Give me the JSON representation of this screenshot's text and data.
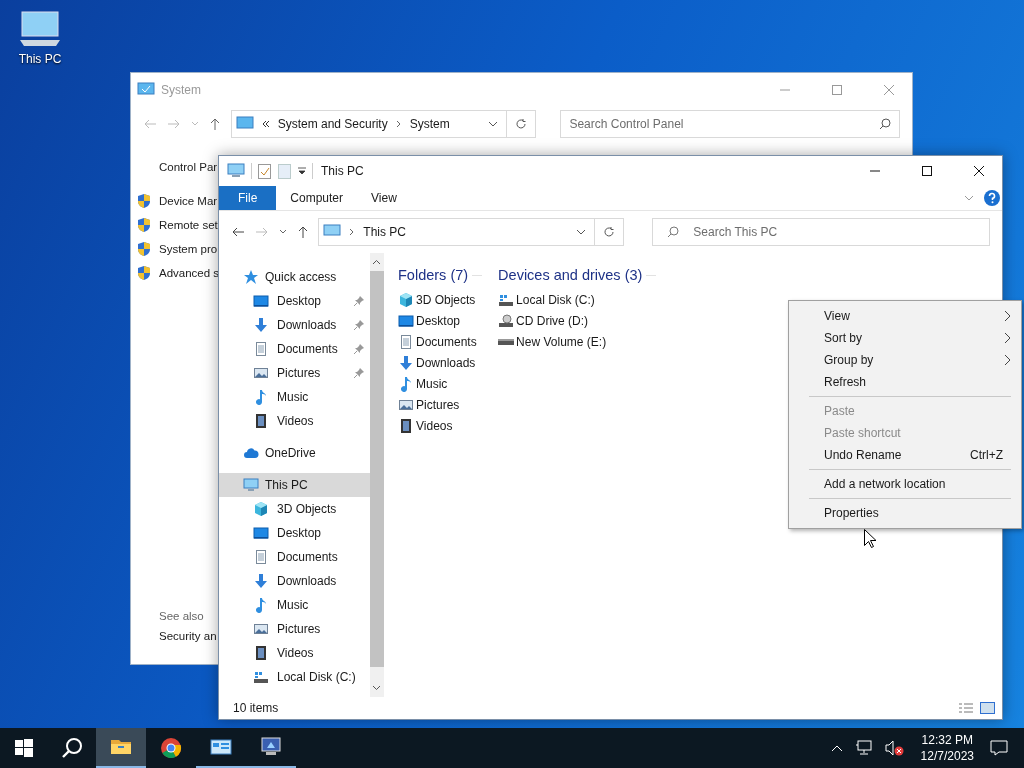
{
  "desktop_icons": [
    {
      "label": "This PC"
    }
  ],
  "system_window": {
    "title": "System",
    "breadcrumb": [
      "System and Security",
      "System"
    ],
    "search": {
      "placeholder": "Search Control Panel"
    },
    "sidebar_heading": "Control Par",
    "links": [
      "Device Mar",
      "Remote set",
      "System pro",
      "Advanced s"
    ],
    "see_also": "See also",
    "see_also_links": [
      "Security an"
    ]
  },
  "explorer": {
    "title": "This PC",
    "ribbon_tabs": [
      {
        "label": "File",
        "selected": true
      },
      {
        "label": "Computer",
        "selected": false
      },
      {
        "label": "View",
        "selected": false
      }
    ],
    "address": "This PC",
    "search": {
      "placeholder": "Search This PC"
    },
    "nav": [
      {
        "label": "Quick access",
        "kind": "star",
        "selected": false,
        "children": [
          {
            "label": "Desktop",
            "kind": "desktop",
            "pinned": true
          },
          {
            "label": "Downloads",
            "kind": "download",
            "pinned": true
          },
          {
            "label": "Documents",
            "kind": "documents",
            "pinned": true
          },
          {
            "label": "Pictures",
            "kind": "pictures",
            "pinned": true
          },
          {
            "label": "Music",
            "kind": "music",
            "pinned": false
          },
          {
            "label": "Videos",
            "kind": "videos",
            "pinned": false
          }
        ]
      },
      {
        "label": "OneDrive",
        "kind": "cloud",
        "selected": false
      },
      {
        "label": "This PC",
        "kind": "pc",
        "selected": true,
        "children": [
          {
            "label": "3D Objects",
            "kind": "cube",
            "pinned": false
          },
          {
            "label": "Desktop",
            "kind": "desktop",
            "pinned": false
          },
          {
            "label": "Documents",
            "kind": "documents",
            "pinned": false
          },
          {
            "label": "Downloads",
            "kind": "download",
            "pinned": false
          },
          {
            "label": "Music",
            "kind": "music",
            "pinned": false
          },
          {
            "label": "Pictures",
            "kind": "pictures",
            "pinned": false
          },
          {
            "label": "Videos",
            "kind": "videos",
            "pinned": false
          },
          {
            "label": "Local Disk (C:)",
            "kind": "disk",
            "pinned": false
          }
        ]
      }
    ],
    "groups": [
      {
        "title": "Folders (7)",
        "items": [
          {
            "label": "3D Objects",
            "kind": "cube"
          },
          {
            "label": "Desktop",
            "kind": "desktop"
          },
          {
            "label": "Documents",
            "kind": "documents"
          },
          {
            "label": "Downloads",
            "kind": "download"
          },
          {
            "label": "Music",
            "kind": "music"
          },
          {
            "label": "Pictures",
            "kind": "pictures"
          },
          {
            "label": "Videos",
            "kind": "videos"
          }
        ]
      },
      {
        "title": "Devices and drives (3)",
        "items": [
          {
            "label": "Local Disk (C:)",
            "kind": "disk"
          },
          {
            "label": "CD Drive (D:)",
            "kind": "cd"
          },
          {
            "label": "New Volume (E:)",
            "kind": "volume"
          }
        ]
      }
    ],
    "status": "10 items"
  },
  "context_menu": [
    {
      "kind": "submenu",
      "label": "View",
      "disabled": false
    },
    {
      "kind": "submenu",
      "label": "Sort by",
      "disabled": false
    },
    {
      "kind": "submenu",
      "label": "Group by",
      "disabled": false
    },
    {
      "kind": "item",
      "label": "Refresh",
      "disabled": false
    },
    {
      "kind": "separator"
    },
    {
      "kind": "item",
      "label": "Paste",
      "disabled": true
    },
    {
      "kind": "item",
      "label": "Paste shortcut",
      "disabled": true
    },
    {
      "kind": "item",
      "label": "Undo Rename",
      "disabled": false,
      "shortcut": "Ctrl+Z"
    },
    {
      "kind": "separator"
    },
    {
      "kind": "item",
      "label": "Add a network location",
      "disabled": false
    },
    {
      "kind": "separator"
    },
    {
      "kind": "item",
      "label": "Properties",
      "disabled": false
    }
  ],
  "taskbar": {
    "apps": [
      {
        "kind": "folder",
        "active": true,
        "running": true
      },
      {
        "kind": "chrome",
        "active": false,
        "running": false
      },
      {
        "kind": "control",
        "active": false,
        "running": true
      },
      {
        "kind": "system",
        "active": false,
        "running": true
      }
    ],
    "time": "12:32 PM",
    "date": "12/7/2023"
  }
}
